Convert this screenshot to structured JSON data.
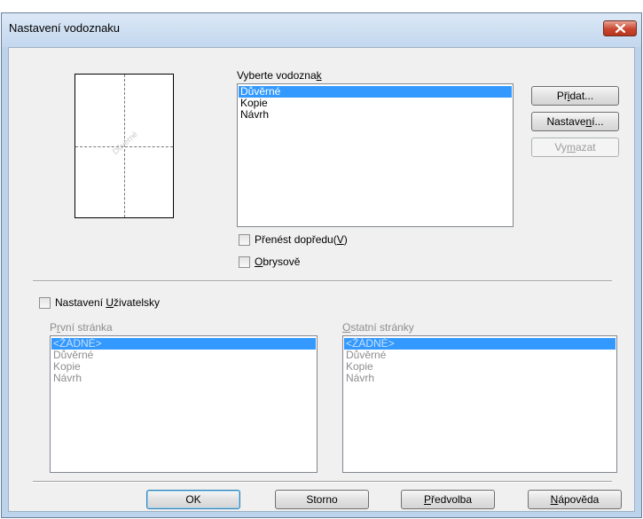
{
  "window": {
    "title": "Nastavení vodoznaku"
  },
  "preview": {
    "watermark_text": "Důvěrné"
  },
  "watermark_select": {
    "label_prefix": "Vyberte vodozna",
    "label_accel": "k",
    "items": [
      "Důvěrné",
      "Kopie",
      "Návrh"
    ],
    "selected": "Důvěrné"
  },
  "buttons": {
    "add": {
      "pre": "Př",
      "accel": "i",
      "post": "dat..."
    },
    "settings": {
      "pre": "Nastave",
      "accel": "n",
      "post": "í..."
    },
    "delete": {
      "pre": "Vy",
      "accel": "m",
      "post": "azat"
    }
  },
  "checkboxes": {
    "bring_front": {
      "pre": "Přenést dopředu(",
      "accel": "V",
      "post": ")",
      "checked": false
    },
    "outline": {
      "pre": "",
      "accel": "O",
      "post": "brysově",
      "checked": false
    },
    "custom": {
      "pre": "Nastavení ",
      "accel": "U",
      "post": "živatelsky",
      "checked": false
    }
  },
  "first_page": {
    "label_pre": "P",
    "label_accel": "r",
    "label_post": "vní stránka",
    "items": [
      "<ŽÁDNÉ>",
      "Důvěrné",
      "Kopie",
      "Návrh"
    ],
    "selected": "<ŽÁDNÉ>"
  },
  "other_pages": {
    "label_pre": "",
    "label_accel": "O",
    "label_post": "statní stránky",
    "items": [
      "<ŽÁDNÉ>",
      "Důvěrné",
      "Kopie",
      "Návrh"
    ],
    "selected": "<ŽÁDNÉ>"
  },
  "footer": {
    "ok": "OK",
    "cancel": "Storno",
    "defaults": {
      "pre": "",
      "accel": "P",
      "post": "ředvolba"
    },
    "help": {
      "pre": "",
      "accel": "N",
      "post": "ápověda"
    }
  }
}
